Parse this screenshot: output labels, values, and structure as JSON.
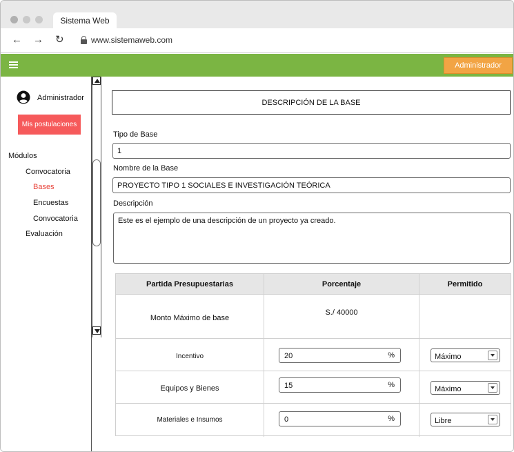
{
  "browser": {
    "tab_title": "Sistema Web",
    "url": "www.sistemaweb.com"
  },
  "header": {
    "user_button": "Administrador",
    "color": "#7bb543",
    "button_color": "#f2a444"
  },
  "sidebar": {
    "username": "Administrador",
    "postulaciones_button": "Mis postulaciones",
    "section_title": "Módulos",
    "items": [
      {
        "label": "Convocatoria",
        "active": false
      },
      {
        "label": "Bases",
        "active": true
      },
      {
        "label": "Encuestas",
        "active": false
      },
      {
        "label": "Convocatoria",
        "active": false
      },
      {
        "label": "Evaluación",
        "active": false
      }
    ]
  },
  "main": {
    "title": "DESCRIPCIÓN DE LA  BASE",
    "tipo_label": "Tipo de Base",
    "tipo_value": "1",
    "nombre_label": "Nombre de la Base",
    "nombre_value": "PROYECTO TIPO 1 SOCIALES E INVESTIGACIÓN TEÓRICA",
    "descripcion_label": "Descripción",
    "descripcion_value": "Este es el ejemplo de una descripción de un proyecto ya creado."
  },
  "table": {
    "headers": [
      "Partida Presupuestarias",
      "Porcentaje",
      "Permitido"
    ],
    "monto_label": "Monto Máximo de base",
    "monto_value": "S./ 40000",
    "rows": [
      {
        "partida": "Incentivo",
        "porcentaje": "20",
        "unit": "%",
        "permitido": "Máximo"
      },
      {
        "partida": "Equipos y Bienes",
        "porcentaje": "15",
        "unit": "%",
        "permitido": "Máximo"
      },
      {
        "partida": "Materiales e Insumos",
        "porcentaje": "0",
        "unit": "%",
        "permitido": "Libre"
      }
    ]
  }
}
